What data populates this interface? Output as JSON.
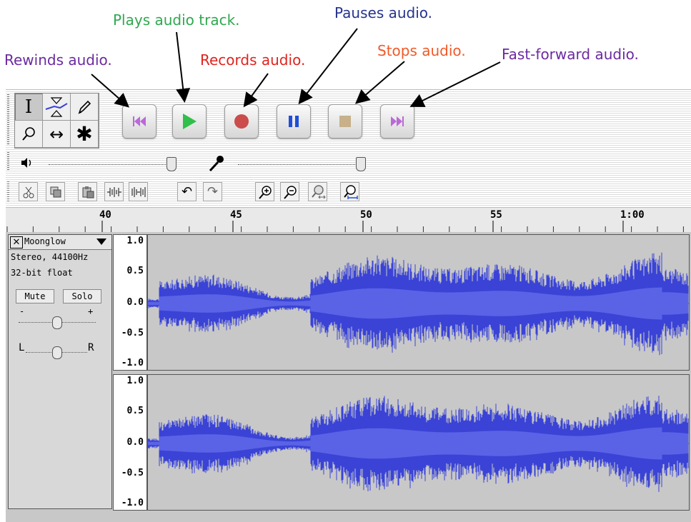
{
  "annotations": {
    "rewind": "Rewinds audio.",
    "play": "Plays audio track.",
    "record": "Records audio.",
    "pause": "Pauses audio.",
    "stop": "Stops audio.",
    "fast_forward": "Fast-forward audio."
  },
  "colors": {
    "rewind": "#6b2aa0",
    "play": "#2fa84f",
    "record": "#e0231e",
    "pause": "#25338e",
    "stop": "#f05a28",
    "fast_forward": "#6b2aa0",
    "waveform": "#3a43d6"
  },
  "tools": {
    "items": [
      "selection-tool",
      "envelope-tool",
      "draw-tool",
      "zoom-tool",
      "time-shift-tool",
      "multi-tool"
    ],
    "symbols": [
      "I",
      "",
      "✎",
      "⚲",
      "↔",
      "✱"
    ]
  },
  "transport": {
    "buttons": [
      "rewind",
      "play",
      "record",
      "pause",
      "stop",
      "fast-forward"
    ]
  },
  "mixer": {
    "output_icon": "speaker-icon",
    "input_icon": "microphone-icon"
  },
  "edit_toolbar": {
    "icons": [
      "cut-icon",
      "copy-icon",
      "paste-icon",
      "trim-icon",
      "silence-icon",
      "undo-icon",
      "redo-icon",
      "zoom-in-icon",
      "zoom-out-icon",
      "fit-selection-icon",
      "fit-project-icon"
    ]
  },
  "ruler": {
    "labels": [
      "40",
      "45",
      "50",
      "55",
      "1:00"
    ]
  },
  "track": {
    "name": "Moonglow",
    "format": "Stereo, 44100Hz",
    "sample_format": "32-bit float",
    "mute_label": "Mute",
    "solo_label": "Solo",
    "gain_minus": "-",
    "gain_plus": "+",
    "pan_left": "L",
    "pan_right": "R",
    "scale_labels": [
      "1.0",
      "0.5",
      "0.0",
      "-0.5",
      "-1.0"
    ]
  }
}
